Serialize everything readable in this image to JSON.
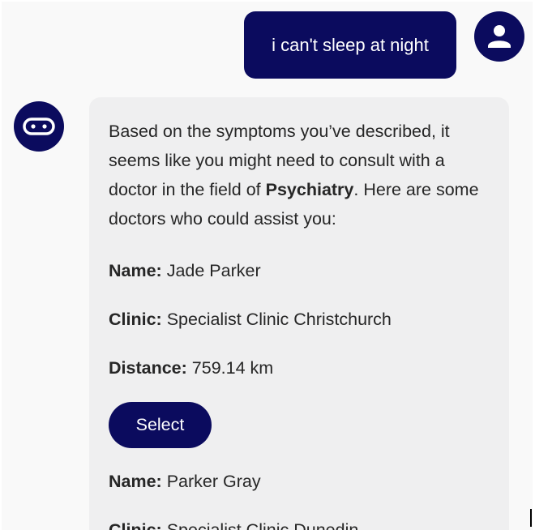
{
  "user_message": "i can't sleep at night",
  "icons": {
    "user_avatar": "person-icon",
    "bot_avatar": "robot-icon"
  },
  "colors": {
    "accent": "#0b0b5e",
    "bot_bubble": "#efeff0",
    "background": "#f9f9f9"
  },
  "bot_message": {
    "intro_before": "Based on the symptoms you’ve described, it seems like you might need to consult with a doctor in the field of ",
    "specialty": "Psychiatry",
    "intro_after": ". Here are some doctors who could assist you:",
    "doctors": [
      {
        "name_label": "Name:",
        "name": "Jade Parker",
        "clinic_label": "Clinic:",
        "clinic": "Specialist Clinic Christchurch",
        "distance_label": "Distance:",
        "distance": "759.14 km",
        "select_label": "Select"
      },
      {
        "name_label": "Name:",
        "name": "Parker Gray",
        "clinic_label": "Clinic:",
        "clinic": "Specialist Clinic Dunedin"
      }
    ]
  }
}
